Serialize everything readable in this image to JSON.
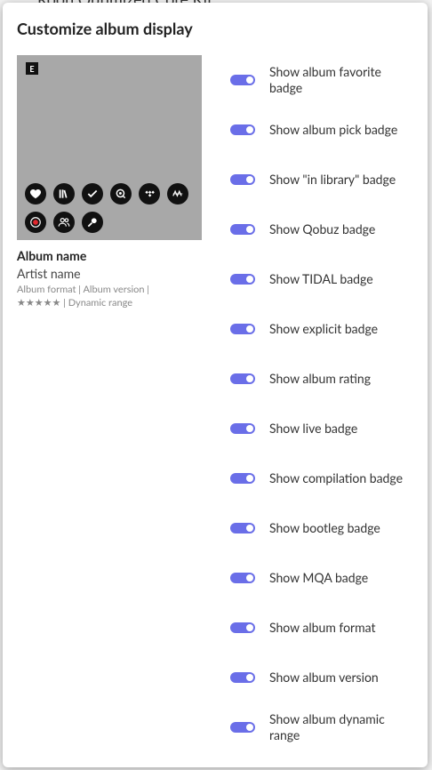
{
  "background": {
    "title": "Roon Optimized Core Kit"
  },
  "modal": {
    "title": "Customize album display",
    "preview": {
      "explicit_badge": "E",
      "badges_row1": [
        "heart-icon",
        "library-icon",
        "check-icon",
        "qobuz-icon",
        "tidal-icon",
        "mqa-icon"
      ],
      "badges_row2": [
        "live-icon",
        "compilation-icon",
        "bootleg-icon"
      ],
      "album_name": "Album name",
      "artist_name": "Artist name",
      "meta_line1": "Album format | Album version |",
      "meta_line2": "★★★★★ | Dynamic range"
    },
    "options": [
      {
        "label": "Show album favorite badge",
        "on": true
      },
      {
        "label": "Show album pick badge",
        "on": true
      },
      {
        "label": "Show \"in library\" badge",
        "on": true
      },
      {
        "label": "Show Qobuz badge",
        "on": true
      },
      {
        "label": "Show TIDAL badge",
        "on": true
      },
      {
        "label": "Show explicit badge",
        "on": true
      },
      {
        "label": "Show album rating",
        "on": true
      },
      {
        "label": "Show live badge",
        "on": true
      },
      {
        "label": "Show compilation badge",
        "on": true
      },
      {
        "label": "Show bootleg badge",
        "on": true
      },
      {
        "label": "Show MQA badge",
        "on": true
      },
      {
        "label": "Show album format",
        "on": true
      },
      {
        "label": "Show album version",
        "on": true
      },
      {
        "label": "Show album dynamic range",
        "on": true
      }
    ],
    "accent_color": "#6a6ee8"
  }
}
